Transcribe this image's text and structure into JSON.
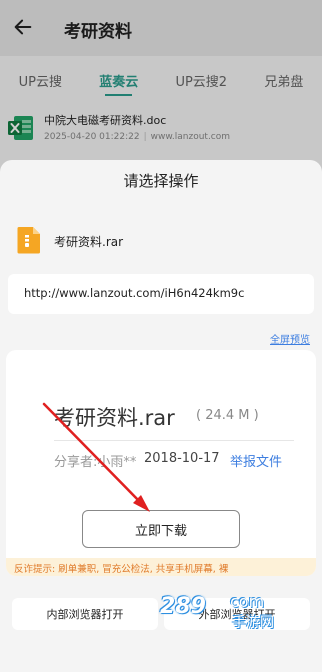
{
  "header": {
    "title": "考研资料"
  },
  "tabs": [
    {
      "label": "UP云搜",
      "active": false
    },
    {
      "label": "蓝奏云",
      "active": true
    },
    {
      "label": "UP云搜2",
      "active": false
    },
    {
      "label": "兄弟盘",
      "active": false
    }
  ],
  "result_item": {
    "name": "中院大电磁考研资料.doc",
    "datetime": "2025-04-20 01:22:22",
    "source": "www.lanzout.com",
    "separator": "|",
    "icon": "excel-file-icon"
  },
  "sheet": {
    "title": "请选择操作",
    "file": {
      "name": "考研资料.rar",
      "icon": "archive-file-icon"
    },
    "url": "http://www.lanzout.com/iH6n424km9c",
    "fullscreen_label": "全屏预览",
    "preview": {
      "title": "考研资料.rar",
      "size": "( 24.4 M )",
      "sharer": "分享者:小雨**",
      "date": "2018-10-17",
      "report": "举报文件",
      "download": "立即下载",
      "warning": "反诈提示: 刷单兼职, 冒充公检法, 共享手机屏幕, 裸"
    },
    "buttons": {
      "internal": "内部浏览器打开",
      "external": "外部浏览器打开"
    }
  },
  "watermark": {
    "brand": "289",
    "suffix": "com",
    "cn": "手游网"
  },
  "colors": {
    "accent": "#2a9c8c",
    "link": "#3d7ee0",
    "warning": "#e07b2b",
    "arrow": "#e02020"
  }
}
